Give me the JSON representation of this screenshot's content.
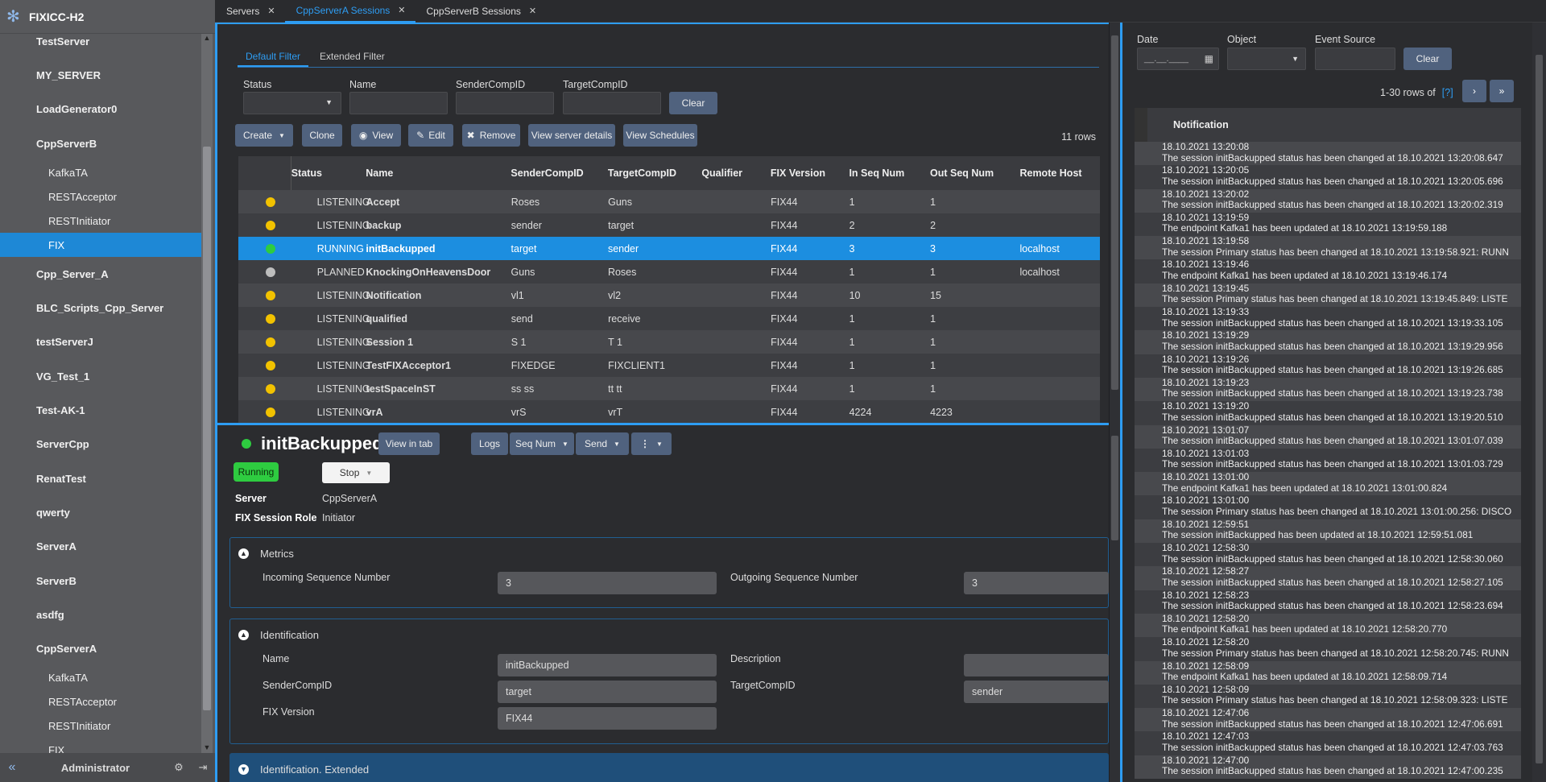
{
  "app": {
    "title": "FIXICC-H2",
    "user": "Administrator"
  },
  "sidebar": {
    "items": [
      {
        "label": "TestServer",
        "child": false
      },
      {
        "label": "MY_SERVER",
        "child": false
      },
      {
        "label": "LoadGenerator0",
        "child": false
      },
      {
        "label": "CppServerB",
        "child": false
      },
      {
        "label": "KafkaTA",
        "child": true
      },
      {
        "label": "RESTAcceptor",
        "child": true
      },
      {
        "label": "RESTInitiator",
        "child": true
      },
      {
        "label": "FIX",
        "child": true,
        "active": true
      },
      {
        "label": "Cpp_Server_A",
        "child": false
      },
      {
        "label": "BLC_Scripts_Cpp_Server",
        "child": false
      },
      {
        "label": "testServerJ",
        "child": false
      },
      {
        "label": "VG_Test_1",
        "child": false
      },
      {
        "label": "Test-AK-1",
        "child": false
      },
      {
        "label": "ServerCpp",
        "child": false
      },
      {
        "label": "RenatTest",
        "child": false
      },
      {
        "label": "qwerty",
        "child": false
      },
      {
        "label": "ServerA",
        "child": false
      },
      {
        "label": "ServerB",
        "child": false
      },
      {
        "label": "asdfg",
        "child": false
      },
      {
        "label": "CppServerA",
        "child": false
      },
      {
        "label": "KafkaTA",
        "child": true
      },
      {
        "label": "RESTAcceptor",
        "child": true
      },
      {
        "label": "RESTInitiator",
        "child": true
      },
      {
        "label": "FIX",
        "child": true
      }
    ]
  },
  "tabs": [
    {
      "label": "Servers"
    },
    {
      "label": "CppServerA Sessions",
      "active": true
    },
    {
      "label": "CppServerB Sessions"
    }
  ],
  "filter": {
    "tabs": [
      "Default Filter",
      "Extended Filter"
    ],
    "labels": {
      "status": "Status",
      "name": "Name",
      "sender": "SenderCompID",
      "target": "TargetCompID"
    },
    "clear": "Clear"
  },
  "toolbar": {
    "create": "Create",
    "clone": "Clone",
    "view": "View",
    "edit": "Edit",
    "remove": "Remove",
    "details": "View server details",
    "schedules": "View Schedules",
    "rows": "11 rows"
  },
  "grid": {
    "columns": [
      "Status",
      "Name",
      "SenderCompID",
      "TargetCompID",
      "Qualifier",
      "FIX Version",
      "In Seq Num",
      "Out Seq Num",
      "Remote Host"
    ],
    "rows": [
      {
        "dot": "#f2c200",
        "status": "LISTENING",
        "name": "Accept",
        "sender": "Roses",
        "target": "Guns",
        "qualifier": "",
        "version": "FIX44",
        "in": "1",
        "out": "1",
        "host": ""
      },
      {
        "dot": "#f2c200",
        "status": "LISTENING",
        "name": "backup",
        "sender": "sender",
        "target": "target",
        "qualifier": "",
        "version": "FIX44",
        "in": "2",
        "out": "2",
        "host": ""
      },
      {
        "dot": "#2ecc40",
        "status": "RUNNING",
        "name": "initBackupped",
        "sender": "target",
        "target": "sender",
        "qualifier": "",
        "version": "FIX44",
        "in": "3",
        "out": "3",
        "host": "localhost",
        "selected": true
      },
      {
        "dot": "#bdbdbd",
        "status": "PLANNED",
        "name": "KnockingOnHeavensDoor",
        "sender": "Guns",
        "target": "Roses",
        "qualifier": "",
        "version": "FIX44",
        "in": "1",
        "out": "1",
        "host": "localhost"
      },
      {
        "dot": "#f2c200",
        "status": "LISTENING",
        "name": "Notification",
        "sender": "vl1",
        "target": "vl2",
        "qualifier": "",
        "version": "FIX44",
        "in": "10",
        "out": "15",
        "host": ""
      },
      {
        "dot": "#f2c200",
        "status": "LISTENING",
        "name": "qualified",
        "sender": "send",
        "target": "receive",
        "qualifier": "",
        "version": "FIX44",
        "in": "1",
        "out": "1",
        "host": ""
      },
      {
        "dot": "#f2c200",
        "status": "LISTENING",
        "name": "Session 1",
        "sender": "S 1",
        "target": "T 1",
        "qualifier": "",
        "version": "FIX44",
        "in": "1",
        "out": "1",
        "host": ""
      },
      {
        "dot": "#f2c200",
        "status": "LISTENING",
        "name": "TestFIXAcceptor1",
        "sender": "FIXEDGE",
        "target": "FIXCLIENT1",
        "qualifier": "",
        "version": "FIX44",
        "in": "1",
        "out": "1",
        "host": ""
      },
      {
        "dot": "#f2c200",
        "status": "LISTENING",
        "name": "testSpaceInST",
        "sender": "ss ss",
        "target": "tt tt",
        "qualifier": "",
        "version": "FIX44",
        "in": "1",
        "out": "1",
        "host": ""
      },
      {
        "dot": "#f2c200",
        "status": "LISTENING",
        "name": "vrA",
        "sender": "vrS",
        "target": "vrT",
        "qualifier": "",
        "version": "FIX44",
        "in": "4224",
        "out": "4223",
        "host": ""
      }
    ]
  },
  "details": {
    "title": "initBackupped",
    "view_in_tab": "View in tab",
    "logs": "Logs",
    "seqnum": "Seq Num",
    "send": "Send",
    "state": "Running",
    "stop": "Stop",
    "server_label": "Server",
    "server": "CppServerA",
    "role_label": "FIX Session Role",
    "role": "Initiator",
    "metrics": {
      "title": "Metrics",
      "in_label": "Incoming Sequence Number",
      "in": "3",
      "out_label": "Outgoing Sequence Number",
      "out": "3"
    },
    "ident": {
      "title": "Identification",
      "name_label": "Name",
      "name": "initBackupped",
      "desc_label": "Description",
      "desc": "",
      "sender_label": "SenderCompID",
      "sender": "target",
      "target_label": "TargetCompID",
      "target": "sender",
      "version_label": "FIX Version",
      "version": "FIX44"
    },
    "ident_ext": {
      "title": "Identification. Extended"
    }
  },
  "events": {
    "labels": {
      "date": "Date",
      "object": "Object",
      "source": "Event Source"
    },
    "date_placeholder": "__.__.____",
    "clear": "Clear",
    "rows_of": "1-30 rows of",
    "rows_q": "[?]",
    "column": "Notification",
    "rows": [
      {
        "t": "18.10.2021 13:20:08",
        "m": "The session initBackupped status has been changed at 18.10.2021 13:20:08.647"
      },
      {
        "t": "18.10.2021 13:20:05",
        "m": "The session initBackupped status has been changed at 18.10.2021 13:20:05.696"
      },
      {
        "t": "18.10.2021 13:20:02",
        "m": "The session initBackupped status has been changed at 18.10.2021 13:20:02.319"
      },
      {
        "t": "18.10.2021 13:19:59",
        "m": "The endpoint Kafka1 has been updated at 18.10.2021 13:19:59.188"
      },
      {
        "t": "18.10.2021 13:19:58",
        "m": "The session Primary status has been changed at 18.10.2021 13:19:58.921: RUNN"
      },
      {
        "t": "18.10.2021 13:19:46",
        "m": "The endpoint Kafka1 has been updated at 18.10.2021 13:19:46.174"
      },
      {
        "t": "18.10.2021 13:19:45",
        "m": "The session Primary status has been changed at 18.10.2021 13:19:45.849: LISTE"
      },
      {
        "t": "18.10.2021 13:19:33",
        "m": "The session initBackupped status has been changed at 18.10.2021 13:19:33.105"
      },
      {
        "t": "18.10.2021 13:19:29",
        "m": "The session initBackupped status has been changed at 18.10.2021 13:19:29.956"
      },
      {
        "t": "18.10.2021 13:19:26",
        "m": "The session initBackupped status has been changed at 18.10.2021 13:19:26.685"
      },
      {
        "t": "18.10.2021 13:19:23",
        "m": "The session initBackupped status has been changed at 18.10.2021 13:19:23.738"
      },
      {
        "t": "18.10.2021 13:19:20",
        "m": "The session initBackupped status has been changed at 18.10.2021 13:19:20.510"
      },
      {
        "t": "18.10.2021 13:01:07",
        "m": "The session initBackupped status has been changed at 18.10.2021 13:01:07.039"
      },
      {
        "t": "18.10.2021 13:01:03",
        "m": "The session initBackupped status has been changed at 18.10.2021 13:01:03.729"
      },
      {
        "t": "18.10.2021 13:01:00",
        "m": "The endpoint Kafka1 has been updated at 18.10.2021 13:01:00.824"
      },
      {
        "t": "18.10.2021 13:01:00",
        "m": "The session Primary status has been changed at 18.10.2021 13:01:00.256: DISCO"
      },
      {
        "t": "18.10.2021 12:59:51",
        "m": "The session initBackupped has been updated at 18.10.2021 12:59:51.081"
      },
      {
        "t": "18.10.2021 12:58:30",
        "m": "The session initBackupped status has been changed at 18.10.2021 12:58:30.060"
      },
      {
        "t": "18.10.2021 12:58:27",
        "m": "The session initBackupped status has been changed at 18.10.2021 12:58:27.105"
      },
      {
        "t": "18.10.2021 12:58:23",
        "m": "The session initBackupped status has been changed at 18.10.2021 12:58:23.694"
      },
      {
        "t": "18.10.2021 12:58:20",
        "m": "The endpoint Kafka1 has been updated at 18.10.2021 12:58:20.770"
      },
      {
        "t": "18.10.2021 12:58:20",
        "m": "The session Primary status has been changed at 18.10.2021 12:58:20.745: RUNN"
      },
      {
        "t": "18.10.2021 12:58:09",
        "m": "The endpoint Kafka1 has been updated at 18.10.2021 12:58:09.714"
      },
      {
        "t": "18.10.2021 12:58:09",
        "m": "The session Primary status has been changed at 18.10.2021 12:58:09.323: LISTE"
      },
      {
        "t": "18.10.2021 12:47:06",
        "m": "The session initBackupped status has been changed at 18.10.2021 12:47:06.691"
      },
      {
        "t": "18.10.2021 12:47:03",
        "m": "The session initBackupped status has been changed at 18.10.2021 12:47:03.763"
      },
      {
        "t": "18.10.2021 12:47:00",
        "m": "The session initBackupped status has been changed at 18.10.2021 12:47:00.235"
      }
    ]
  }
}
